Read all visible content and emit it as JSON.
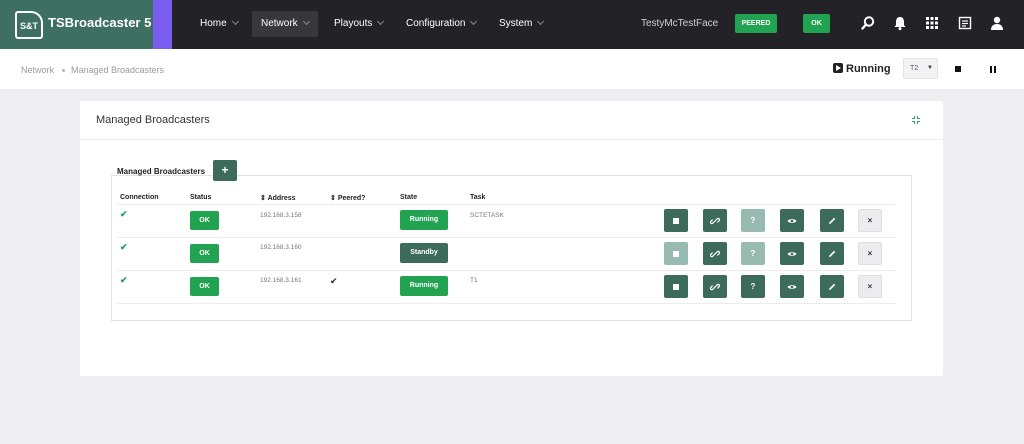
{
  "app": {
    "logo_text": "S&T",
    "title": "TSBroadcaster 5"
  },
  "nav": [
    {
      "label": "Home",
      "active": false
    },
    {
      "label": "Network",
      "active": true
    },
    {
      "label": "Playouts",
      "active": false
    },
    {
      "label": "Configuration",
      "active": false
    },
    {
      "label": "System",
      "active": false
    }
  ],
  "header": {
    "user": "TestyMcTestFace",
    "peered_label": "PEERED",
    "ok_label": "OK",
    "icons": [
      "search-icon",
      "bell-icon",
      "grid-icon",
      "document-icon",
      "user-icon"
    ]
  },
  "breadcrumb": [
    "Network",
    "Managed Broadcasters"
  ],
  "status": {
    "running_label": "Running",
    "selected": "T2"
  },
  "card": {
    "title": "Managed Broadcasters",
    "section_title": "Managed Broadcasters",
    "add_label": "+"
  },
  "table": {
    "headers": {
      "connection": "Connection",
      "status": "Status",
      "address": "Address",
      "peered": "Peered?",
      "state": "State",
      "task": "Task"
    },
    "rows": [
      {
        "connected": "✔",
        "status": "OK",
        "address": "192.168.3.158",
        "peered": "",
        "state": "Running",
        "task": "SCTETASK",
        "stop_enabled": true,
        "help_enabled": false
      },
      {
        "connected": "✔",
        "status": "OK",
        "address": "192.168.3.160",
        "peered": "",
        "state": "Standby",
        "task": "",
        "stop_enabled": false,
        "help_enabled": false
      },
      {
        "connected": "✔",
        "status": "OK",
        "address": "192.168.3.161",
        "peered": "✔",
        "state": "Running",
        "task": "T1",
        "stop_enabled": true,
        "help_enabled": true
      }
    ],
    "help_label": "?",
    "delete_label": "×"
  },
  "colors": {
    "brand": "#3d7061",
    "accent": "#7a5df0",
    "success": "#22a351",
    "action": "#3c6b5c"
  }
}
